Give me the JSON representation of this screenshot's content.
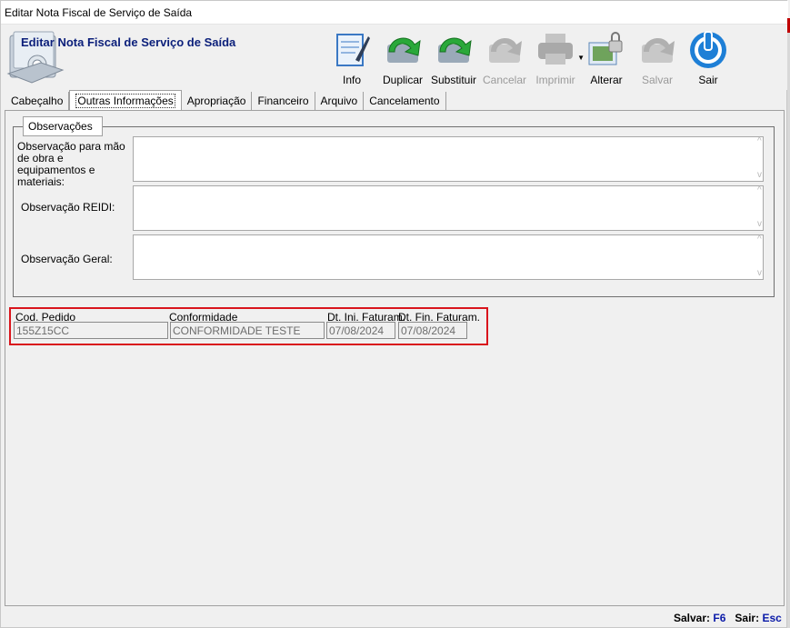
{
  "window": {
    "title": "Editar Nota Fiscal de Serviço de Saída"
  },
  "header": {
    "heading": "Editar Nota Fiscal de Serviço de Saída"
  },
  "toolbar": {
    "buttons": [
      {
        "label": "Info",
        "icon": "info-notepad-icon",
        "enabled": true
      },
      {
        "label": "Duplicar",
        "icon": "duplicate-arrow-icon",
        "enabled": true
      },
      {
        "label": "Substituir",
        "icon": "replace-arrow-icon",
        "enabled": true
      },
      {
        "label": "Cancelar",
        "icon": "cancel-arrow-icon",
        "enabled": false
      },
      {
        "label": "Imprimir",
        "icon": "printer-icon",
        "enabled": false
      },
      {
        "label": "Alterar",
        "icon": "edit-lock-icon",
        "enabled": true
      },
      {
        "label": "Salvar",
        "icon": "save-arrow-icon",
        "enabled": false
      },
      {
        "label": "Sair",
        "icon": "power-icon",
        "enabled": true
      }
    ]
  },
  "tabs": [
    {
      "label": "Cabeçalho",
      "active": false
    },
    {
      "label": "Outras Informações",
      "active": true
    },
    {
      "label": "Apropriação",
      "active": false
    },
    {
      "label": "Financeiro",
      "active": false
    },
    {
      "label": "Arquivo",
      "active": false
    },
    {
      "label": "Cancelamento",
      "active": false
    }
  ],
  "observacoes": {
    "group_title": "Observações",
    "obs_mao_obra_label": "Observação para mão de obra e equipamentos e materiais:",
    "obs_reidi_label": "Observação REIDI:",
    "obs_geral_label": "Observação Geral:"
  },
  "fields": {
    "cod_pedido": {
      "label": "Cod. Pedido",
      "value": "155Z15CC"
    },
    "conformidade": {
      "label": "Conformidade",
      "value": "CONFORMIDADE TESTE"
    },
    "dt_ini": {
      "label": "Dt. Ini. Faturam.",
      "value": "07/08/2024"
    },
    "dt_fin": {
      "label": "Dt. Fin. Faturam.",
      "value": "07/08/2024"
    }
  },
  "statusbar": {
    "save_label": "Salvar:",
    "save_key": "F6",
    "exit_label": "Sair:",
    "exit_key": "Esc"
  },
  "colors": {
    "heading": "#0b1f7a",
    "highlight_border": "#d9141c",
    "shortcut_key": "#0a1aa8"
  }
}
